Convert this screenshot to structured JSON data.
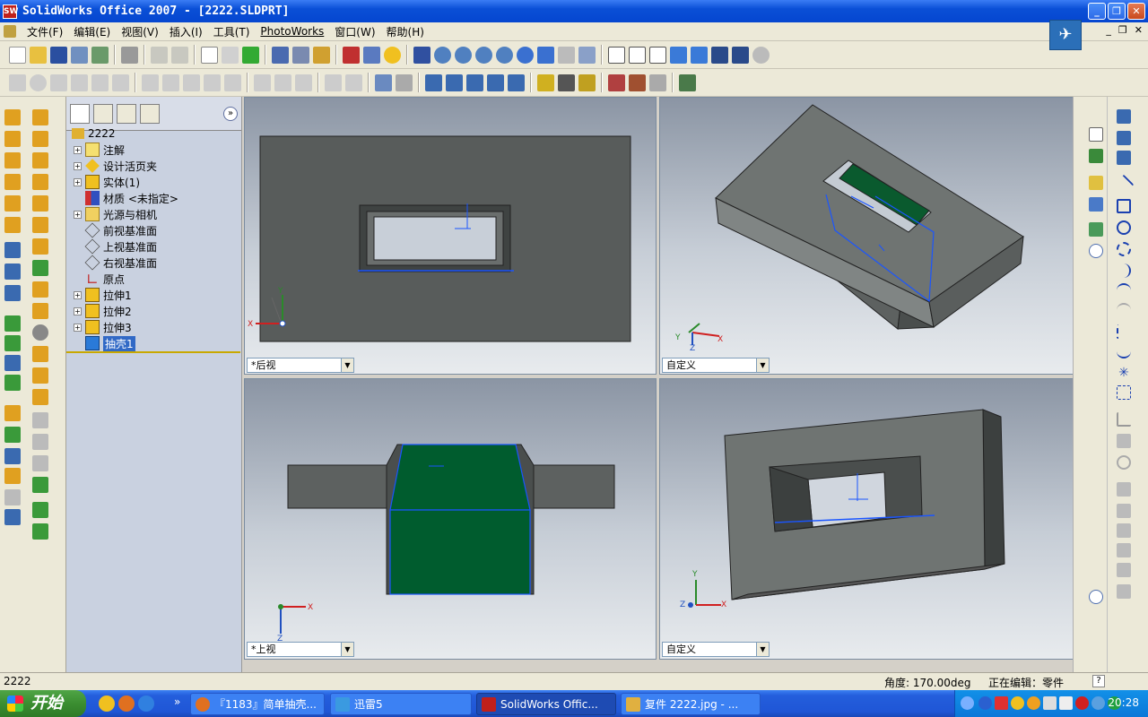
{
  "window": {
    "title": "SolidWorks Office 2007 - [2222.SLDPRT]",
    "app_icon_text": "SW"
  },
  "menu": {
    "items": [
      "文件(F)",
      "编辑(E)",
      "视图(V)",
      "插入(I)",
      "工具(T)",
      "PhotoWorks",
      "窗口(W)",
      "帮助(H)"
    ]
  },
  "tree": {
    "root": "2222",
    "items": [
      {
        "label": "注解",
        "expandable": true
      },
      {
        "label": "设计活页夹",
        "expandable": true
      },
      {
        "label": "实体(1)",
        "expandable": true
      },
      {
        "label": "材质 <未指定>",
        "expandable": false
      },
      {
        "label": "光源与相机",
        "expandable": true
      },
      {
        "label": "前视基准面",
        "expandable": false
      },
      {
        "label": "上视基准面",
        "expandable": false
      },
      {
        "label": "右视基准面",
        "expandable": false
      },
      {
        "label": "原点",
        "expandable": false
      },
      {
        "label": "拉伸1",
        "expandable": true
      },
      {
        "label": "拉伸2",
        "expandable": true
      },
      {
        "label": "拉伸3",
        "expandable": true
      },
      {
        "label": "抽壳1",
        "expandable": false,
        "selected": true
      }
    ]
  },
  "viewports": [
    {
      "view": "*后视"
    },
    {
      "view": "自定义"
    },
    {
      "view": "*上视"
    },
    {
      "view": "自定义"
    }
  ],
  "axes": {
    "x": "X",
    "y": "Y",
    "z": "Z"
  },
  "status": {
    "left": "2222",
    "angle": "角度: 170.00deg",
    "mode": "正在编辑：零件",
    "help": "?"
  },
  "taskbar": {
    "start": "开始",
    "tasks": [
      "『1183』简单抽壳...",
      "迅雷5",
      "SolidWorks Offic...",
      "复件 2222.jpg - ..."
    ],
    "clock": "20:28",
    "quicklaunch_more": "»"
  },
  "colors": {
    "face_green": "#005c2e",
    "edge_blue": "#1a55ff",
    "body_gray": "#6f7472",
    "title_blue": "#0a4fd6"
  }
}
